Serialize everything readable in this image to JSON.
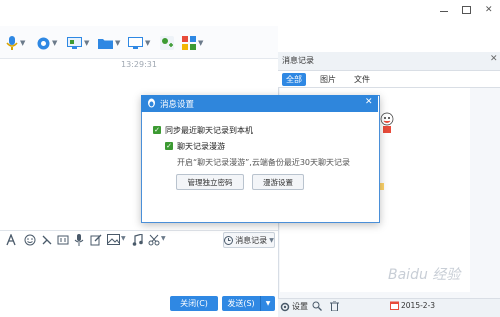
{
  "chat": {
    "timestamp": "13:29:31",
    "close_label": "关闭(C)",
    "send_label": "发送(S)",
    "send_arrow": "▼",
    "msg_record_label": "消息记录",
    "msg_record_chevron": "▼"
  },
  "toolbar": {
    "chevron": "▼"
  },
  "right_panel": {
    "title": "消息记录",
    "close": "✕",
    "tabs": [
      {
        "label": "全部"
      },
      {
        "label": "图片"
      },
      {
        "label": "文件"
      }
    ],
    "settings_label": "设置",
    "date_label": "2015-2-3"
  },
  "dialog": {
    "title": "消息设置",
    "close": "✕",
    "option1_label": "同步最近聊天记录到本机",
    "option2_label": "聊天记录漫游",
    "description": "开启“聊天记录漫游”,云端备份最近30天聊天记录",
    "button_manage": "管理独立密码",
    "button_roaming": "漫游设置",
    "checkmark": "✓"
  },
  "watermark": "Baidu 经验",
  "colors": {
    "accent": "#2f88e3",
    "dialog_title_bg": "#2f86dc",
    "checkbox_green": "#3c9a32"
  }
}
